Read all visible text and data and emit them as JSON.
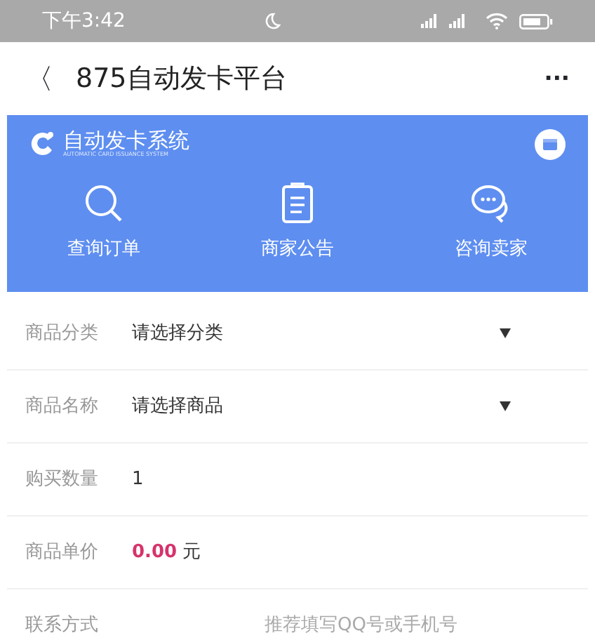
{
  "status_bar": {
    "time": "下午3:42"
  },
  "header": {
    "back": "〈",
    "title": "875自动发卡平台",
    "more": "···"
  },
  "banner": {
    "logo_text": "自动发卡系统",
    "logo_subtitle": "AUTOMATIC CARD ISSUANCE SYSTEM",
    "actions": [
      {
        "kind": "search",
        "label": "查询订单"
      },
      {
        "kind": "notice",
        "label": "商家公告"
      },
      {
        "kind": "chat",
        "label": "咨询卖家"
      }
    ]
  },
  "form": [
    {
      "kind": "select",
      "label": "商品分类",
      "value": "请选择分类"
    },
    {
      "kind": "select",
      "label": "商品名称",
      "value": "请选择商品"
    },
    {
      "kind": "number",
      "label": "购买数量",
      "value": "1"
    },
    {
      "kind": "price",
      "label": "商品单价",
      "value": "0.00",
      "unit": "元"
    },
    {
      "kind": "text",
      "label": "联系方式",
      "placeholder": "推荐填写QQ号或手机号"
    }
  ]
}
